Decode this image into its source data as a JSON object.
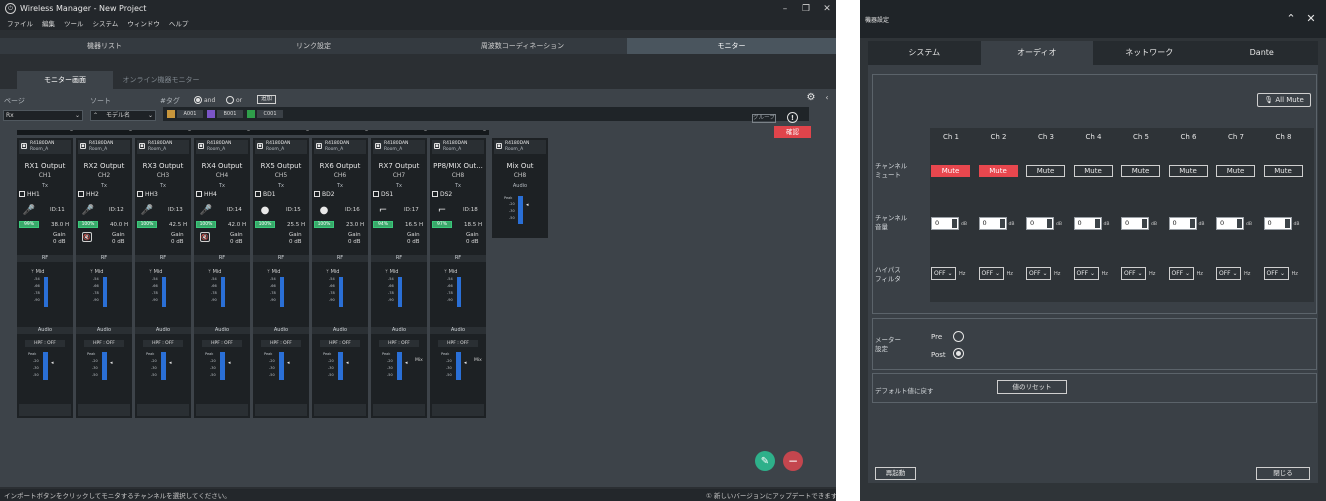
{
  "main": {
    "title": "Wireless Manager - New Project",
    "menu": [
      "ファイル",
      "編集",
      "ツール",
      "システム",
      "ウィンドウ",
      "ヘルプ"
    ],
    "tabs": [
      "機器リスト",
      "リンク設定",
      "周波数コーディネーション",
      "モニター"
    ],
    "subtabs": [
      "モニター画面",
      "オンライン機器モニター"
    ],
    "filter": {
      "page_label": "ページ",
      "sort_label": "ソート",
      "tag_label": "#タグ",
      "page_value": "Rx",
      "sort_value": "モデル名",
      "and_label": "and",
      "or_label": "or",
      "add_label": "追加",
      "tags": [
        {
          "name": "A001",
          "color": "#c8963c"
        },
        {
          "name": "B001",
          "color": "#7b55c7"
        },
        {
          "name": "C001",
          "color": "#2f9e4a"
        }
      ],
      "group_label": "グループ",
      "confirm_label": "確認",
      "alert": "!"
    },
    "strips": [
      {
        "model": "R4180DAN",
        "room": "Room_A",
        "name": "RX1 Output",
        "ch": "CH1",
        "tx_label": "Tx",
        "tx_name": "HH1",
        "id": "ID:11",
        "battery": "99%",
        "time": "38.0 H",
        "gain_label": "Gain",
        "gain": "0 dB",
        "rf_label": "RF",
        "rf_level": "Mid",
        "audio_label": "Audio",
        "hpf": "HPF : OFF",
        "mic": "handheld"
      },
      {
        "model": "R4180DAN",
        "room": "Room_A",
        "name": "RX2 Output",
        "ch": "CH2",
        "tx_label": "Tx",
        "tx_name": "HH2",
        "id": "ID:12",
        "battery": "100%",
        "time": "40.0 H",
        "gain_label": "Gain",
        "gain": "0 dB",
        "rf_label": "RF",
        "rf_level": "Mid",
        "audio_label": "Audio",
        "hpf": "HPF : OFF",
        "mic": "handheld",
        "muted": true
      },
      {
        "model": "R4180DAN",
        "room": "Room_A",
        "name": "RX3 Output",
        "ch": "CH3",
        "tx_label": "Tx",
        "tx_name": "HH3",
        "id": "ID:13",
        "battery": "100%",
        "time": "42.5 H",
        "gain_label": "Gain",
        "gain": "0 dB",
        "rf_label": "RF",
        "rf_level": "Mid",
        "audio_label": "Audio",
        "hpf": "HPF : OFF",
        "mic": "handheld"
      },
      {
        "model": "R4180DAN",
        "room": "Room_A",
        "name": "RX4 Output",
        "ch": "CH4",
        "tx_label": "Tx",
        "tx_name": "HH4",
        "id": "ID:14",
        "battery": "100%",
        "time": "42.0 H",
        "gain_label": "Gain",
        "gain": "0 dB",
        "rf_label": "RF",
        "rf_level": "Mid",
        "audio_label": "Audio",
        "hpf": "HPF : OFF",
        "mic": "handheld",
        "muted": true
      },
      {
        "model": "R4180DAN",
        "room": "Room_A",
        "name": "RX5 Output",
        "ch": "CH5",
        "tx_label": "Tx",
        "tx_name": "BD1",
        "id": "ID:15",
        "battery": "100%",
        "time": "25.5 H",
        "gain_label": "Gain",
        "gain": "0 dB",
        "rf_label": "RF",
        "rf_level": "Mid",
        "audio_label": "Audio",
        "hpf": "HPF : OFF",
        "mic": "boundary"
      },
      {
        "model": "R4180DAN",
        "room": "Room_A",
        "name": "RX6 Output",
        "ch": "CH6",
        "tx_label": "Tx",
        "tx_name": "BD2",
        "id": "ID:16",
        "battery": "100%",
        "time": "23.0 H",
        "gain_label": "Gain",
        "gain": "0 dB",
        "rf_label": "RF",
        "rf_level": "Mid",
        "audio_label": "Audio",
        "hpf": "HPF : OFF",
        "mic": "boundary"
      },
      {
        "model": "R4180DAN",
        "room": "Room_A",
        "name": "RX7 Output",
        "ch": "CH7",
        "tx_label": "Tx",
        "tx_name": "DS1",
        "id": "ID:17",
        "battery": "94%",
        "time": "16.5 H",
        "gain_label": "Gain",
        "gain": "0 dB",
        "rf_label": "RF",
        "rf_level": "Mid",
        "audio_label": "Audio",
        "hpf": "HPF : OFF",
        "mic": "desk"
      },
      {
        "model": "R4180DAN",
        "room": "Room_A",
        "name": "PP8/MIX Out...",
        "ch": "CH8",
        "tx_label": "Tx",
        "tx_name": "DS2",
        "id": "ID:18",
        "battery": "97%",
        "time": "18.5 H",
        "gain_label": "Gain",
        "gain": "0 dB",
        "rf_label": "RF",
        "rf_level": "Mid",
        "audio_label": "Audio",
        "hpf": "HPF : OFF",
        "mic": "desk"
      }
    ],
    "mix_strip": {
      "model": "R4180DAN",
      "room": "Room_A",
      "name": "Mix Out",
      "ch": "CH8",
      "audio_label": "Audio",
      "peak": "Peak"
    },
    "meter_marks": [
      "-54",
      "-66",
      "-78",
      "-90"
    ],
    "audio_marks": [
      "Peak",
      "-20",
      "-30",
      "-50"
    ],
    "mix_label": "Mix",
    "status_message": "インポートボタンをクリックしてモニタするチャンネルを選択してください。",
    "update_message": "① 新しいバージョンにアップデートできます"
  },
  "panel": {
    "title": "機器設定",
    "tabs": [
      "システム",
      "オーディオ",
      "ネットワーク",
      "Dante"
    ],
    "all_mute": "All Mute",
    "channels": [
      "Ch 1",
      "Ch 2",
      "Ch 3",
      "Ch 4",
      "Ch 5",
      "Ch 6",
      "Ch 7",
      "Ch 8"
    ],
    "row_mute": "チャンネル\nミュート",
    "row_volume": "チャンネル\n音量",
    "row_hpf": "ハイパス\nフィルタ",
    "mute_label": "Mute",
    "mute_states": [
      true,
      true,
      false,
      false,
      false,
      false,
      false,
      false
    ],
    "volume_value": "0",
    "volume_unit": "dB",
    "hpf_value": "OFF",
    "hpf_unit": "Hz",
    "meter_label": "メーター\n設定",
    "pre_label": "Pre",
    "post_label": "Post",
    "meter_selected": "Post",
    "reset_label": "デフォルト値に戻す",
    "reset_button": "値のリセット",
    "reboot_button": "再起動",
    "close_button": "閉じる"
  }
}
